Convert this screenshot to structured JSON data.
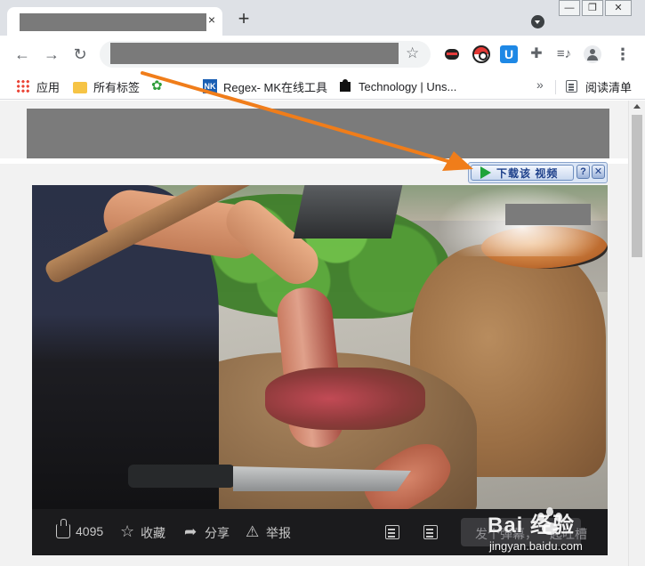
{
  "browser": {
    "tab": {
      "close_glyph": "×"
    },
    "new_tab_glyph": "+",
    "window_controls": {
      "minimize": "—",
      "maximize": "❐",
      "close": "✕"
    },
    "nav": {
      "back": "←",
      "forward": "→",
      "reload": "↻"
    },
    "star_glyph": "☆",
    "ext_u_label": "U",
    "ext_puzzle_glyph": "✚",
    "ext_media_glyph": "≡♪",
    "menu_glyph": "⋮"
  },
  "bookmarks": {
    "apps": "应用",
    "all_bookmarks": "所有标签",
    "item3": "",
    "mk_icon_text": "NK",
    "regex": "Regex- MK在线工具",
    "technology": "Technology | Uns...",
    "more": "»",
    "reading_list": "阅读清单"
  },
  "download_bar": {
    "label": "下载该 视频",
    "help": "?",
    "close": "✕"
  },
  "video_actions": {
    "likes": "4095",
    "favorite": "收藏",
    "share": "分享",
    "report": "举报",
    "danmu_placeholder": "发个弹幕，一起吐槽"
  },
  "watermark": {
    "brand": "Bai 经验",
    "url": "jingyan.baidu.com"
  },
  "colors": {
    "annotation_arrow": "#f07d1a",
    "tabstrip": "#dee1e6",
    "actionbar": "#1b1b1d"
  }
}
